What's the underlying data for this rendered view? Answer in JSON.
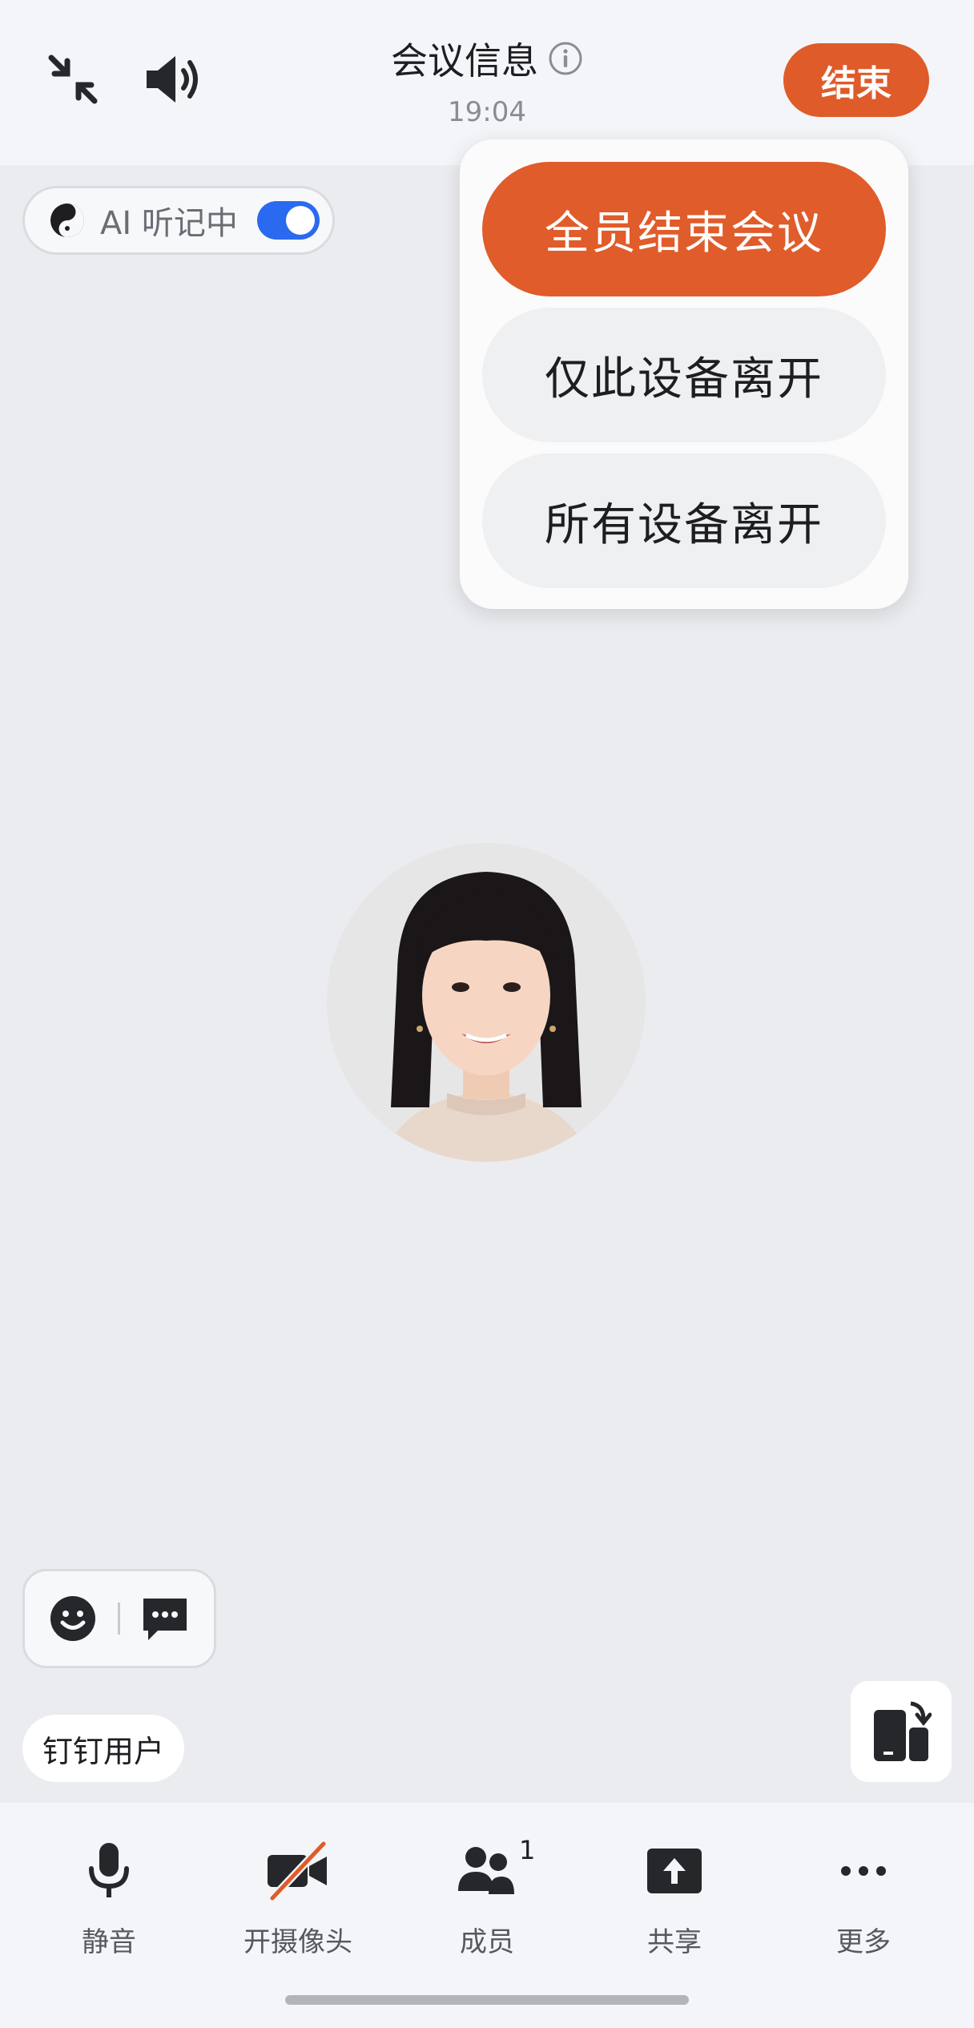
{
  "header": {
    "title": "会议信息",
    "time": "19:04",
    "end_label": "结束"
  },
  "ai_recorder": {
    "label": "AI 听记中",
    "enabled": true
  },
  "end_menu": {
    "items": [
      "全员结束会议",
      "仅此设备离开",
      "所有设备离开"
    ]
  },
  "participant": {
    "name": "钉钉用户"
  },
  "toolbar": {
    "items": [
      {
        "label": "静音",
        "icon": "microphone-icon"
      },
      {
        "label": "开摄像头",
        "icon": "camera-off-icon"
      },
      {
        "label": "成员",
        "icon": "members-icon",
        "badge": "1"
      },
      {
        "label": "共享",
        "icon": "share-icon"
      },
      {
        "label": "更多",
        "icon": "more-icon"
      }
    ]
  },
  "colors": {
    "accent": "#df5b2a",
    "toggle": "#2a6af0",
    "background": "#ebecf0"
  }
}
